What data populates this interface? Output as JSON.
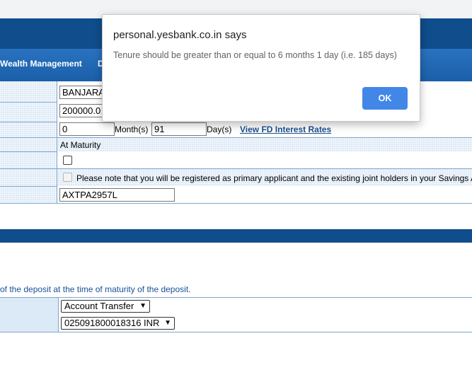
{
  "nav": {
    "items": [
      "Wealth Management",
      "D"
    ]
  },
  "form": {
    "branch_value": "BANJARA",
    "amount_value": "200000.0",
    "tenure": {
      "months_value": "0",
      "months_label": "Month(s)",
      "days_value": "91",
      "days_label": "Day(s)",
      "rates_link": "View FD Interest Rates"
    },
    "payout_text": "At Maturity",
    "joint_note": "Please note that you will be registered as primary applicant and the existing joint holders in your Savings A",
    "pan_value": "AXTPA2957L"
  },
  "maturity": {
    "note": "of the deposit at the time of maturity of the deposit.",
    "mode_selected": "Account Transfer",
    "account_selected": "025091800018316 INR"
  },
  "dialog": {
    "title": "personal.yesbank.co.in says",
    "message": "Tenure should be greater than or equal to 6 months 1 day (i.e. 185 days)",
    "ok_label": "OK"
  },
  "colors": {
    "banner": "#0f4d8c",
    "nav": "#1a5fa8",
    "grid": "#dce9f6",
    "ok_button": "#4287e8",
    "link": "#1a4f8e"
  },
  "icons": {
    "select_arrow": "chevron-down-icon"
  }
}
